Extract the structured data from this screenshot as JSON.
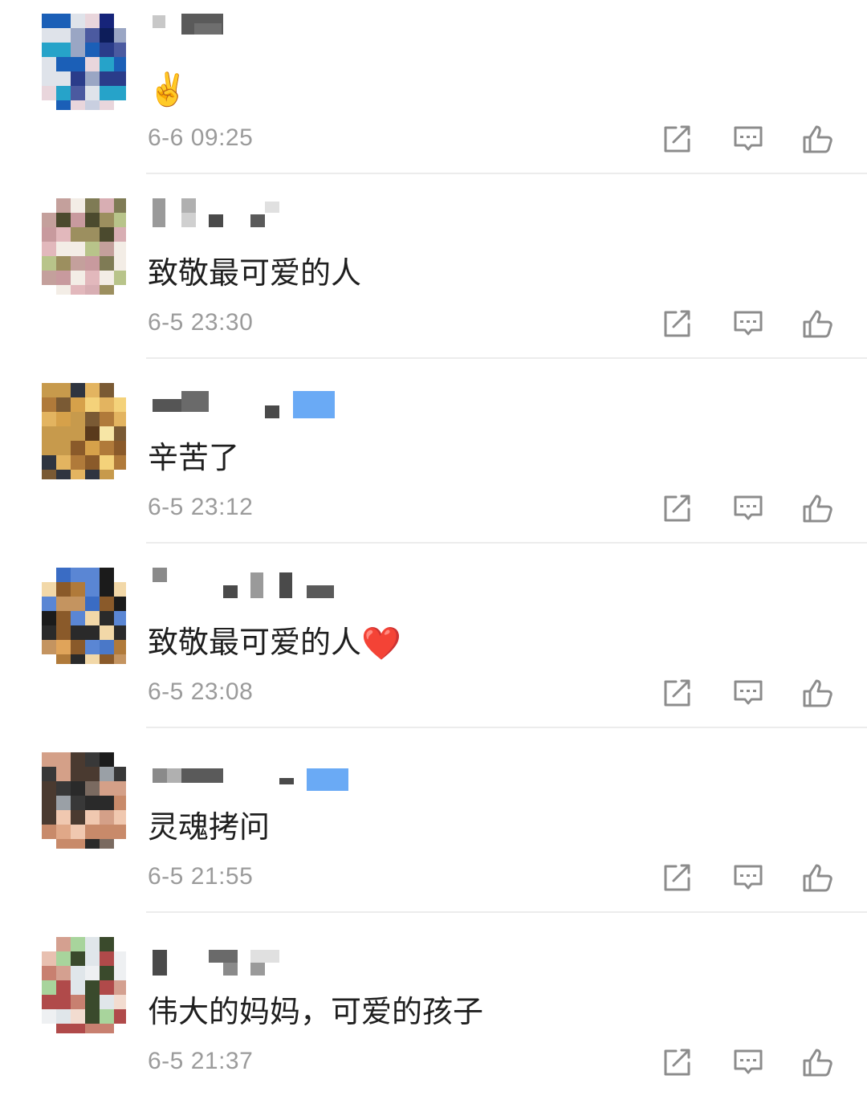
{
  "comments": [
    {
      "text": "",
      "emoji": "✌️",
      "timestamp": "6-6 09:25"
    },
    {
      "text": "致敬最可爱的人",
      "emoji": "",
      "timestamp": "6-5 23:30"
    },
    {
      "text": "辛苦了",
      "emoji": "",
      "timestamp": "6-5 23:12"
    },
    {
      "text": "致敬最可爱的人",
      "emoji": "❤️",
      "timestamp": "6-5 23:08"
    },
    {
      "text": "灵魂拷问",
      "emoji": "",
      "timestamp": "6-5 21:55"
    },
    {
      "text": "伟大的妈妈，可爱的孩子",
      "emoji": "",
      "timestamp": "6-5 21:37"
    }
  ],
  "actions": {
    "repost_icon": "repost-icon",
    "comment_icon": "comment-icon",
    "like_icon": "thumbs-up-icon"
  },
  "colors": {
    "text": "#1f1f1f",
    "timestamp": "#9b9b9b",
    "icon": "#8c8c8c",
    "divider": "#ececec",
    "badge_blue": "#6aaaf5"
  }
}
